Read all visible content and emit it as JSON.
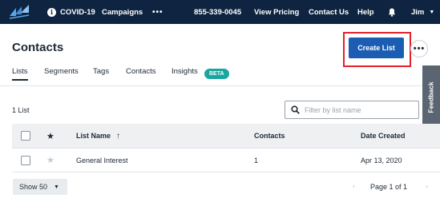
{
  "topnav": {
    "covid": "COVID-19",
    "campaigns": "Campaigns",
    "more": "•••",
    "phone": "855-339-0045",
    "pricing": "View Pricing",
    "contact": "Contact Us",
    "help": "Help",
    "user": "Jim",
    "icons": [
      "logo-icon",
      "info-icon",
      "bell-icon",
      "chevron-down-icon"
    ]
  },
  "page": {
    "title": "Contacts",
    "create_label": "Create List",
    "kebab": "•••"
  },
  "tabs": [
    "Lists",
    "Segments",
    "Tags",
    "Contacts",
    "Insights"
  ],
  "active_tab": "Lists",
  "beta": "BETA",
  "feedback": "Feedback",
  "list_count": "1 List",
  "filter": {
    "placeholder": "Filter by list name",
    "value": ""
  },
  "table": {
    "headers": {
      "star": "★",
      "name": "List Name",
      "sort": "↑",
      "contacts": "Contacts",
      "date": "Date Created"
    },
    "rows": [
      {
        "star": "★",
        "name": "General Interest",
        "contacts": "1",
        "date": "Apr 13, 2020"
      }
    ]
  },
  "footer": {
    "show": "Show 50",
    "prev": "‹",
    "page": "Page 1 of 1",
    "next": "›"
  },
  "colors": {
    "nav_bg": "#0e2440",
    "primary": "#1b5db3",
    "highlight": "#e5202b",
    "beta": "#1aa6a0"
  }
}
